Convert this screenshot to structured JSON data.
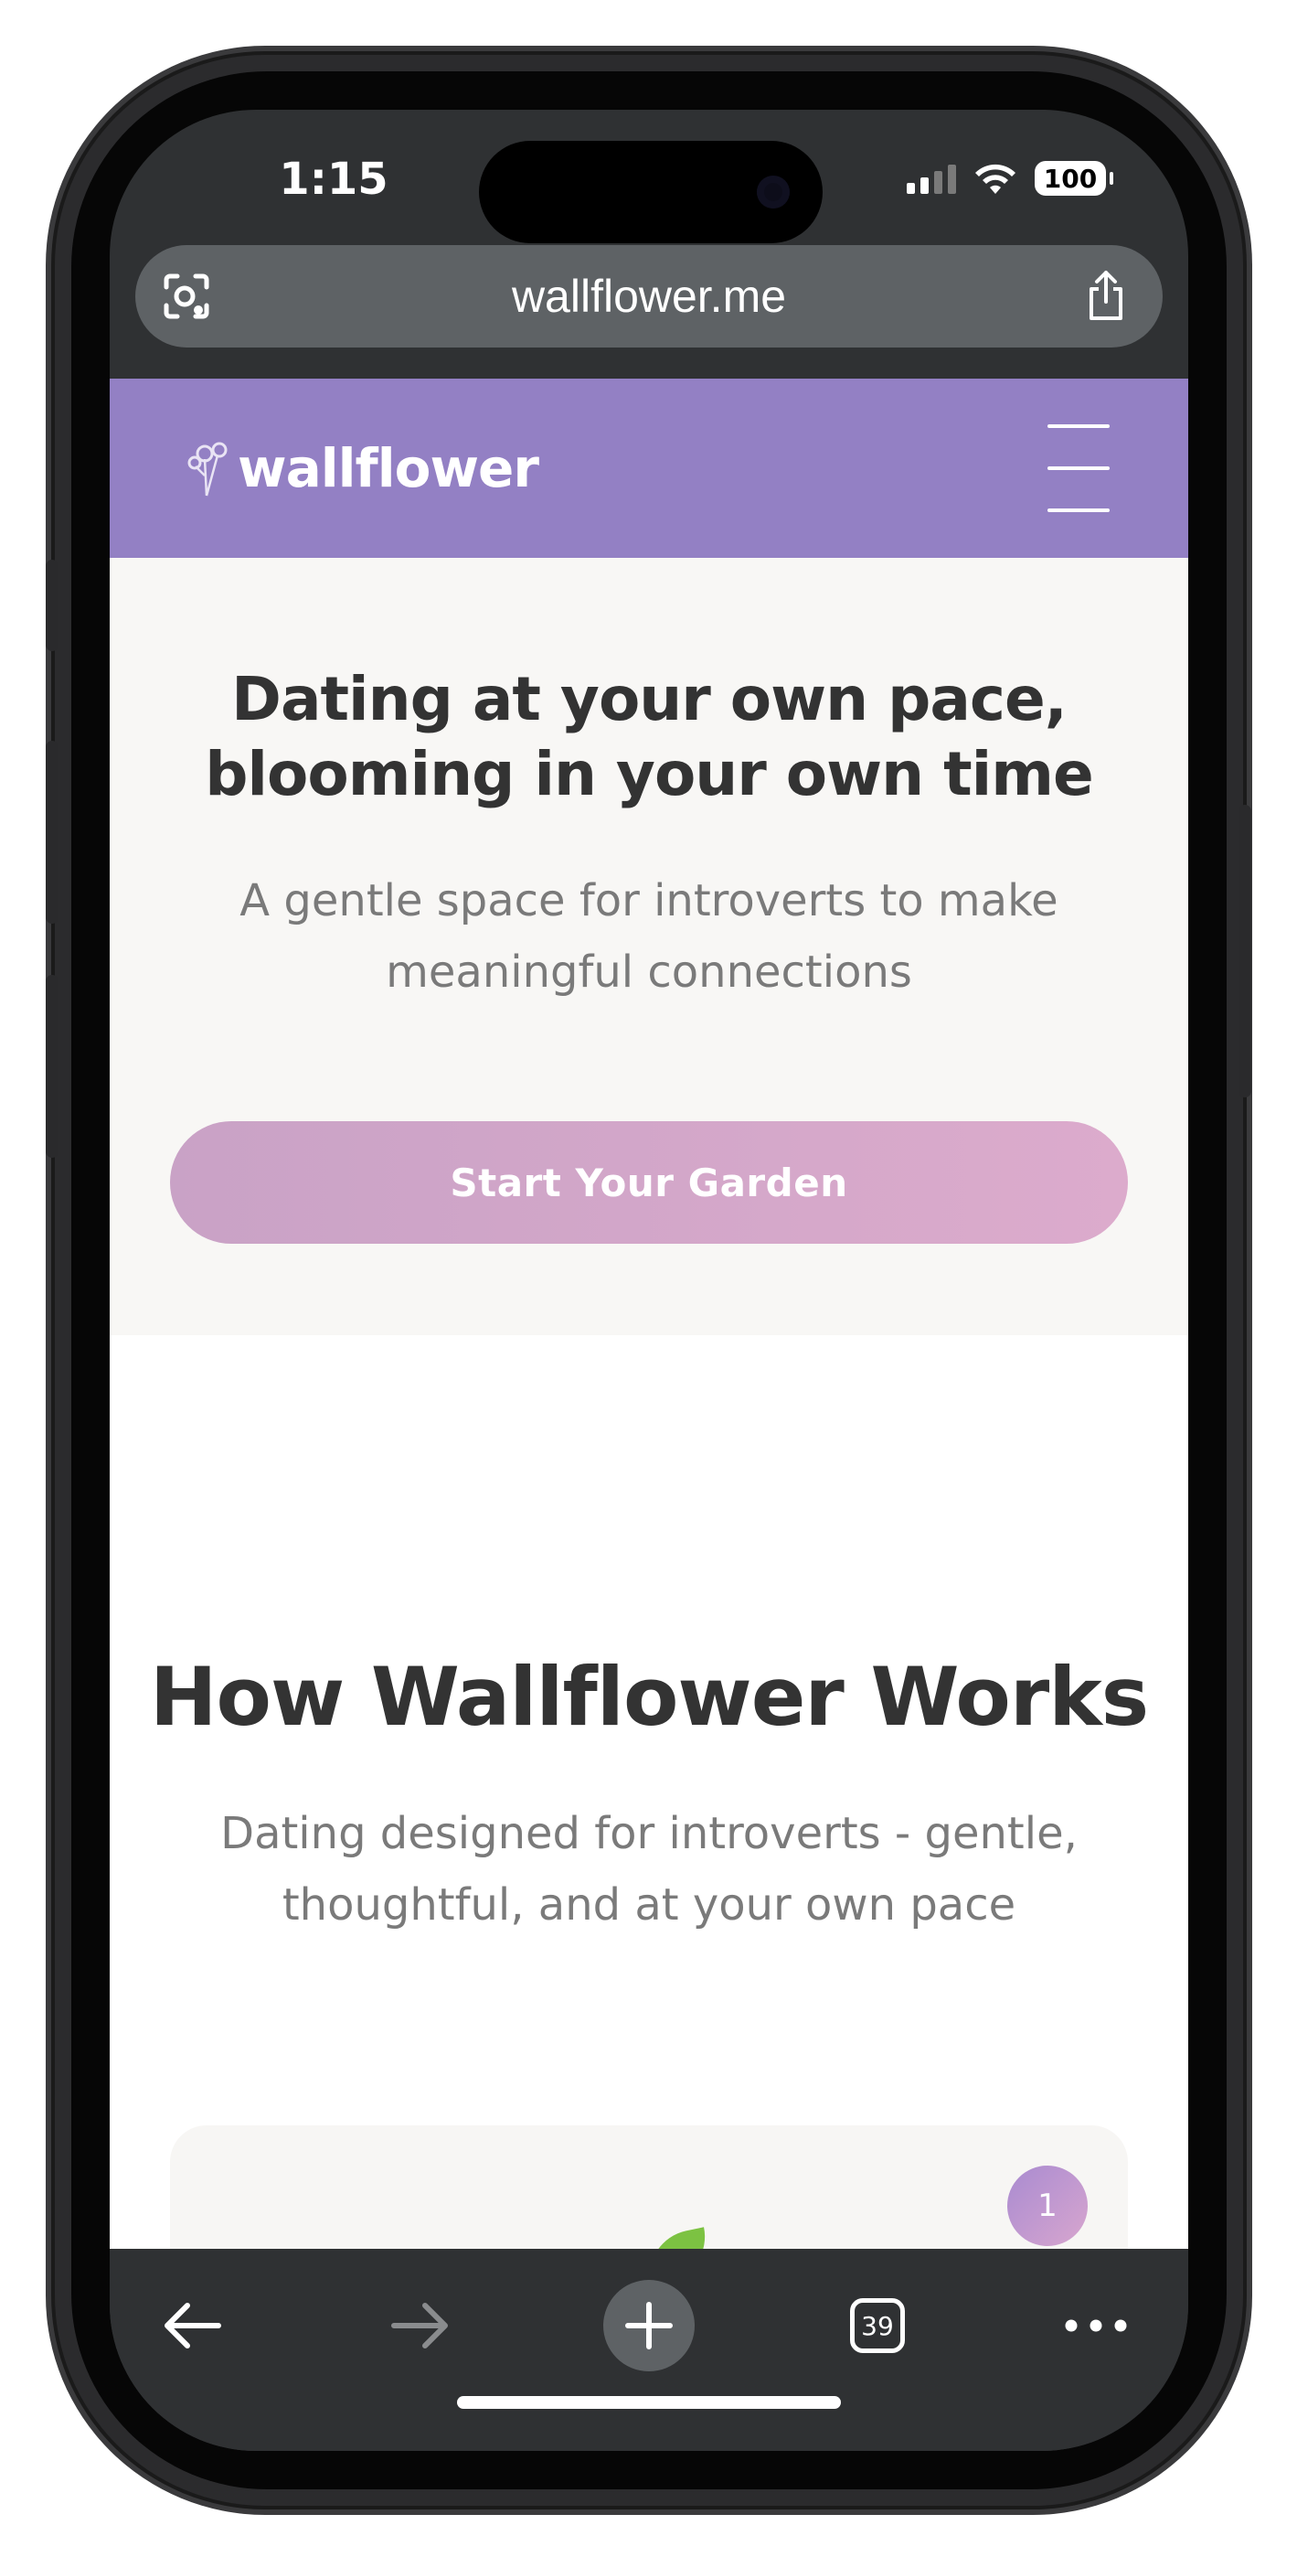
{
  "status_bar": {
    "time": "1:15",
    "battery": "100",
    "icons": [
      "signal-icon",
      "wifi-icon",
      "battery-icon"
    ]
  },
  "browser": {
    "url": "wallflower.me",
    "left_icon": "visual-lookup-icon",
    "right_icon": "share-icon",
    "tab_count": "39",
    "toolbar_icons": [
      "back-arrow-icon",
      "forward-arrow-icon",
      "plus-icon",
      "tabs-icon",
      "more-icon"
    ]
  },
  "site": {
    "logo_text": "wallflower",
    "logo_icon": "flower-icon",
    "menu_icon": "hamburger-icon"
  },
  "hero": {
    "title_line1": "Dating at your own pace,",
    "title_line2": "blooming in your own time",
    "subtitle_line1": "A gentle space for introverts to make",
    "subtitle_line2": "meaningful connections",
    "cta_label": "Start Your Garden"
  },
  "how_it_works": {
    "title": "How Wallflower Works",
    "subtitle_line1": "Dating designed for introverts - gentle,",
    "subtitle_line2": "thoughtful, and at your own pace",
    "step_number": "1"
  },
  "colors": {
    "header_bg": "#9380c4",
    "hero_bg": "#f8f7f5",
    "cta_gradient_start": "#c9a2c6",
    "cta_gradient_end": "#dcabcc",
    "browser_chrome": "#2f3133"
  }
}
